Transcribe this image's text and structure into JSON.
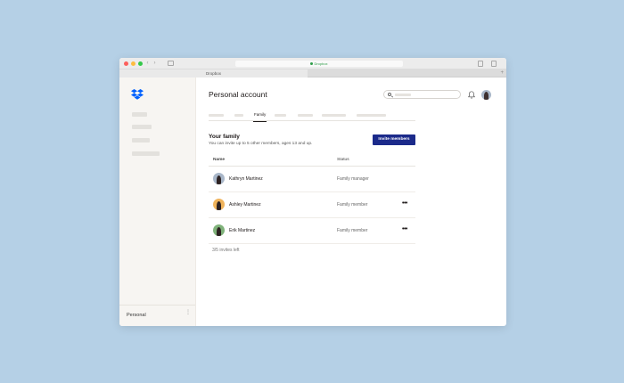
{
  "browser": {
    "url_text": "Dropbox",
    "tab_title": "Dropbox",
    "new_tab_glyph": "+",
    "back_glyph": "‹",
    "forward_glyph": "›"
  },
  "sidebar": {
    "logo_icon": "dropbox-logo-icon",
    "brand_color": "#0061fe",
    "account_label": "Personal",
    "account_menu_glyph": "⋮"
  },
  "header": {
    "title": "Personal account",
    "avatar_icon": "avatar-icon",
    "bell_icon": "bell-icon",
    "search_icon": "search-icon"
  },
  "tabs": {
    "active_label": "Family"
  },
  "family": {
    "title": "Your family",
    "subtitle": "You can invite up to 5 other members, ages 13 and up.",
    "invite_button": "Invite members",
    "invite_button_color": "#1b2a8a",
    "columns": {
      "name": "Name",
      "status": "Status"
    },
    "members": [
      {
        "name": "Kathryn Martinez",
        "status": "Family manager",
        "avatar_color": "#a9b7c9",
        "has_menu": false,
        "menu_glyph": ""
      },
      {
        "name": "Ashley Martinez",
        "status": "Family member",
        "avatar_color": "#f0b45c",
        "has_menu": true,
        "menu_glyph": "•••"
      },
      {
        "name": "Erik Martinez",
        "status": "Family member",
        "avatar_color": "#7fb27a",
        "has_menu": true,
        "menu_glyph": "•••"
      }
    ],
    "invites_left": "3/5 invites left"
  }
}
